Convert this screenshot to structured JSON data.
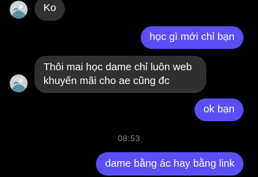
{
  "conversation": {
    "messages": [
      {
        "direction": "incoming",
        "text": "Ko"
      },
      {
        "direction": "outgoing",
        "text": "học gì mới chỉ bạn"
      },
      {
        "direction": "incoming",
        "lines": [
          "Thôi mai học dame chỉ luôn web",
          "khuyến mãi cho ae cũng đc"
        ]
      },
      {
        "direction": "outgoing",
        "text": "ok bạn"
      },
      {
        "direction": "outgoing",
        "text": "dame bằng ác hay bằng link"
      }
    ],
    "timestamp": "08:53"
  },
  "colors": {
    "background": "#000000",
    "incoming_bubble": "#303030",
    "outgoing_bubble": "#5a4ff7",
    "timestamp_text": "#8e8e93"
  },
  "icons": {
    "contact_avatar": "avatar-photo-icon"
  }
}
